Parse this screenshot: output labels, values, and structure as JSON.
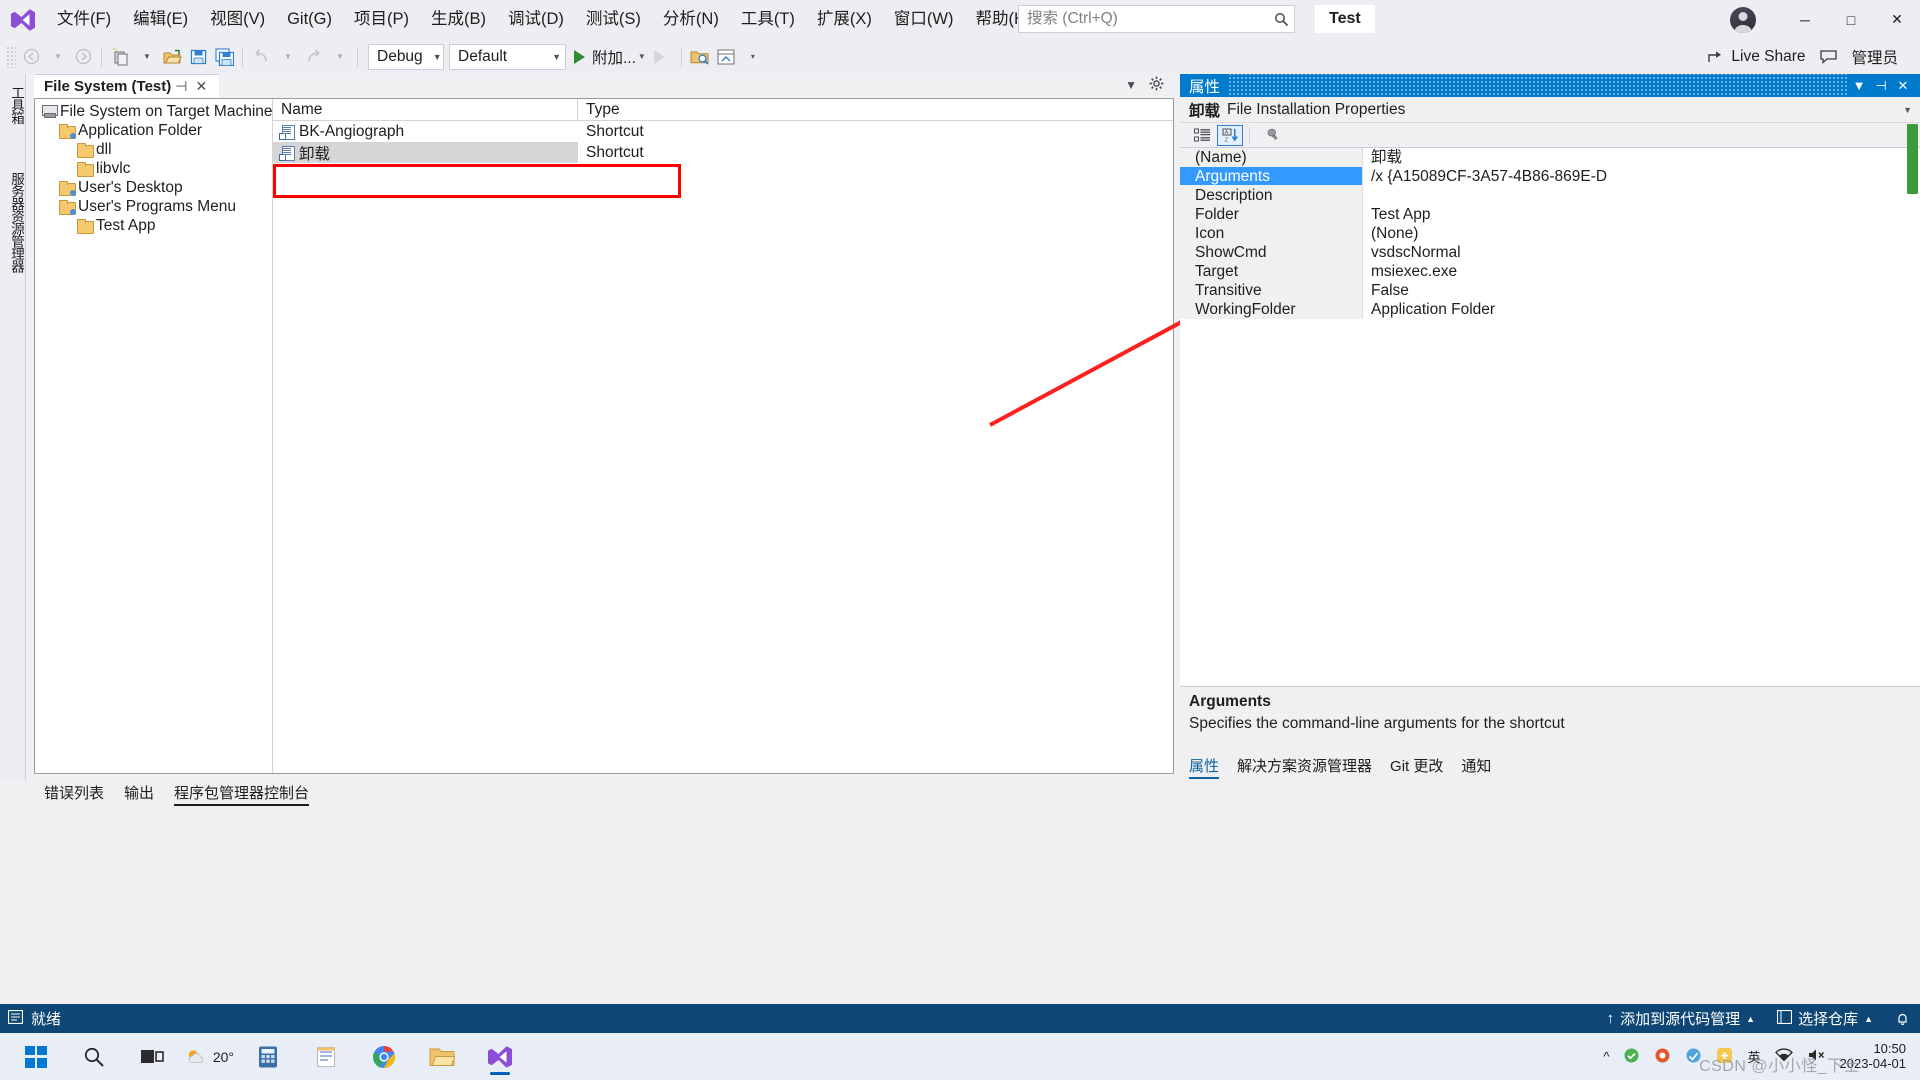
{
  "window": {
    "app_icon": "visual-studio-logo",
    "solution_name": "Test",
    "minimize": "─",
    "maximize": "□",
    "close": "✕"
  },
  "menu": {
    "items": [
      {
        "label": "文件(F)",
        "text": "文件",
        "key": "F"
      },
      {
        "label": "编辑(E)",
        "text": "编辑",
        "key": "E"
      },
      {
        "label": "视图(V)",
        "text": "视图",
        "key": "V"
      },
      {
        "label": "Git(G)",
        "text": "Git",
        "key": "G"
      },
      {
        "label": "项目(P)",
        "text": "项目",
        "key": "P"
      },
      {
        "label": "生成(B)",
        "text": "生成",
        "key": "B"
      },
      {
        "label": "调试(D)",
        "text": "调试",
        "key": "D"
      },
      {
        "label": "测试(S)",
        "text": "测试",
        "key": "S"
      },
      {
        "label": "分析(N)",
        "text": "分析",
        "key": "N"
      },
      {
        "label": "工具(T)",
        "text": "工具",
        "key": "T"
      },
      {
        "label": "扩展(X)",
        "text": "扩展",
        "key": "X"
      },
      {
        "label": "窗口(W)",
        "text": "窗口",
        "key": "W"
      },
      {
        "label": "帮助(H)",
        "text": "帮助",
        "key": "H"
      }
    ]
  },
  "search": {
    "placeholder": "搜索 (Ctrl+Q)",
    "value": "",
    "icon": "search-icon"
  },
  "toolbar": {
    "nav_back": "back-arrow-icon",
    "nav_forward": "forward-arrow-icon",
    "new_project": "new-project-icon",
    "open_file": "open-file-icon",
    "save": "save-icon",
    "save_all": "save-all-icon",
    "undo": "undo-icon",
    "redo": "redo-icon",
    "configuration": "Debug",
    "platform": "Default",
    "attach_label": "附加...",
    "live_share": "Live Share",
    "admin_label": "管理员"
  },
  "vertical_tabs": [
    {
      "label": "工具箱"
    },
    {
      "label": "服务器资源管理器"
    }
  ],
  "document": {
    "tab_title": "File System (Test)",
    "pin_icon": "pin-icon",
    "close_icon": "close-icon"
  },
  "tree": {
    "nodes": [
      {
        "label": "File System on Target Machine",
        "level": 0,
        "icon": "target-machine-icon"
      },
      {
        "label": "Application Folder",
        "level": 1,
        "icon": "special-folder-icon"
      },
      {
        "label": "dll",
        "level": 2,
        "icon": "folder-icon"
      },
      {
        "label": "libvlc",
        "level": 2,
        "icon": "folder-icon"
      },
      {
        "label": "User's Desktop",
        "level": 1,
        "icon": "special-folder-icon"
      },
      {
        "label": "User's Programs Menu",
        "level": 1,
        "icon": "special-folder-icon"
      },
      {
        "label": "Test App",
        "level": 2,
        "icon": "folder-icon"
      }
    ]
  },
  "list": {
    "columns": [
      "Name",
      "Type"
    ],
    "rows": [
      {
        "name": "BK-Angiograph",
        "type": "Shortcut",
        "icon": "shortcut-icon",
        "selected": false
      },
      {
        "name": "卸载",
        "type": "Shortcut",
        "icon": "shortcut-icon",
        "selected": true
      }
    ]
  },
  "bottom_tabs": [
    {
      "label": "错误列表",
      "active": false
    },
    {
      "label": "输出",
      "active": false
    },
    {
      "label": "程序包管理器控制台",
      "active": true
    }
  ],
  "properties": {
    "panel_title": "属性",
    "object_name": "卸载",
    "object_type": "File Installation Properties",
    "toolbar": {
      "categorized": "categorized-icon",
      "alphabetical": "alphabetical-sort-icon",
      "property_pages": "property-pages-icon"
    },
    "rows": [
      {
        "key": "(Name)",
        "value": "卸载",
        "selected": false
      },
      {
        "key": "Arguments",
        "value": "/x {A15089CF-3A57-4B86-869E-D",
        "selected": true
      },
      {
        "key": "Description",
        "value": "",
        "selected": false
      },
      {
        "key": "Folder",
        "value": "Test App",
        "selected": false
      },
      {
        "key": "Icon",
        "value": "(None)",
        "selected": false
      },
      {
        "key": "ShowCmd",
        "value": "vsdscNormal",
        "selected": false
      },
      {
        "key": "Target",
        "value": "msiexec.exe",
        "selected": false
      },
      {
        "key": "Transitive",
        "value": "False",
        "selected": false
      },
      {
        "key": "WorkingFolder",
        "value": "Application Folder",
        "selected": false
      }
    ],
    "description": {
      "title": "Arguments",
      "body": "Specifies the command-line arguments for the shortcut"
    },
    "tabs": [
      {
        "label": "属性",
        "active": true
      },
      {
        "label": "解决方案资源管理器",
        "active": false
      },
      {
        "label": "Git 更改",
        "active": false
      },
      {
        "label": "通知",
        "active": false
      }
    ]
  },
  "statusbar": {
    "ready": "就绪",
    "source_control": "添加到源代码管理",
    "repository": "选择仓库",
    "bell": "notification-bell-icon"
  },
  "taskbar": {
    "start": "start-icon",
    "search": "search-icon",
    "task_view": "task-view-icon",
    "weather_temp": "20°",
    "items": [
      {
        "name": "calculator-icon"
      },
      {
        "name": "notepad-icon"
      },
      {
        "name": "chrome-icon"
      },
      {
        "name": "file-explorer-icon"
      },
      {
        "name": "visual-studio-icon"
      }
    ],
    "tray": {
      "chevron": "show-hidden-icons-icon",
      "ime": "英",
      "network": "network-icon",
      "volume": "volume-muted-icon",
      "time": "10:50",
      "date": "2023-04-01"
    }
  },
  "annotation": {
    "color": "#ff0000",
    "watermark": "CSDN @小小怪_下士"
  }
}
